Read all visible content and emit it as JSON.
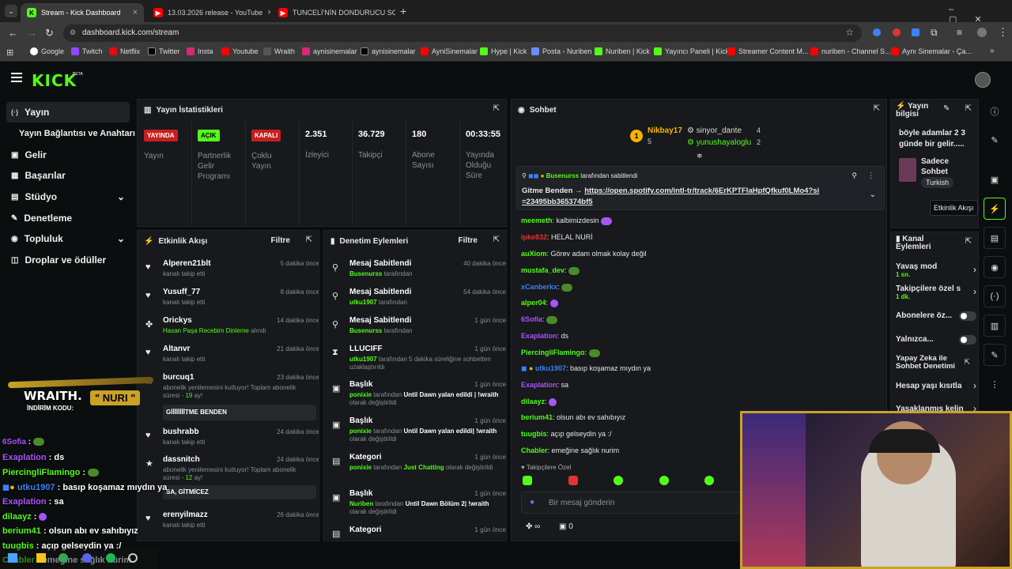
{
  "browser": {
    "tabs": [
      {
        "title": "Stream - Kick Dashboard",
        "active": true,
        "icon": "kick-icon"
      },
      {
        "title": "13.03.2026 release - YouTube",
        "active": false,
        "icon": "youtube-icon"
      },
      {
        "title": "TUNCELİ'NİN DONDURUCU SO",
        "active": false,
        "icon": "youtube-icon"
      }
    ],
    "url": "dashboard.kick.com/stream",
    "bookmarks": [
      "Google",
      "Twitch",
      "Netflix",
      "Twitter",
      "Insta",
      "Youtube",
      "Wraith",
      "aynisinemalar",
      "aynisinemalar",
      "AyniSinemalar",
      "Hype | Kick",
      "Posta - Nuriben",
      "Nuriben | Kick",
      "Yayıncı Paneli | Kick",
      "Streamer Content M...",
      "nuriben - Channel S...",
      "Aynı Sinemalar - Ça..."
    ]
  },
  "brand": {
    "logo": "KICK",
    "beta": "BETA",
    "accent": "#53fc18"
  },
  "sidebar": {
    "items": [
      {
        "label": "Yayın",
        "icon": "broadcast-icon"
      },
      {
        "label": "Yayın Bağlantısı ve Anahtarı",
        "icon": ""
      },
      {
        "label": "Gelir",
        "icon": "money-icon"
      },
      {
        "label": "Başarılar",
        "icon": "trophy-icon"
      },
      {
        "label": "Stüdyo",
        "icon": "studio-icon"
      },
      {
        "label": "Denetleme",
        "icon": "wrench-icon"
      },
      {
        "label": "Topluluk",
        "icon": "community-icon"
      },
      {
        "label": "Droplar ve ödüller",
        "icon": "gift-icon"
      }
    ]
  },
  "stats": {
    "title": "Yayın İstatistikleri",
    "badges": [
      {
        "badge": "YAYINDA",
        "label": "Yayın",
        "color": "#e3342f"
      },
      {
        "badge": "AÇIK",
        "label": "Partnerlik Gelir Programı",
        "color": "#53fc18"
      },
      {
        "badge": "KAPALI",
        "label": "Çoklu Yayın",
        "color": "#e3342f"
      }
    ],
    "numbers": [
      {
        "value": "2.351",
        "label": "İzleyici"
      },
      {
        "value": "36.729",
        "label": "Takipçi"
      },
      {
        "value": "180",
        "label": "Abone Sayısı"
      },
      {
        "value": "00:33:55",
        "label": "Yayında Olduğu Süre"
      }
    ]
  },
  "activity": {
    "title": "Etkinlik Akışı",
    "filter": "Filtre",
    "items": [
      {
        "name": "Alperen21blt",
        "time": "5 dakika önce",
        "sub": "kanalı takip etti",
        "icon": "heart-icon"
      },
      {
        "name": "Yusuff_77",
        "time": "8 dakika önce",
        "sub": "kanalı takip etti",
        "icon": "heart-icon"
      },
      {
        "name": "Orickys",
        "time": "14 dakika önce",
        "sub": "Hasan Paşa Recebim Dinleme",
        "sub2": "alındı",
        "icon": "points-icon"
      },
      {
        "name": "Altanvr",
        "time": "21 dakika önce",
        "sub": "kanalı takip etti",
        "icon": "heart-icon"
      },
      {
        "name": "burcuq1",
        "time": "23 dakika önce",
        "sub": "abonelik yenilemesini kutluyor! Toplam abonelik süresi - ",
        "months": "19",
        "sub3": " ay!",
        "message": "GİİİİİİİİTME BENDEN",
        "icon": "star-icon"
      },
      {
        "name": "bushrabb",
        "time": "24 dakika önce",
        "sub": "kanalı takip etti",
        "icon": "heart-icon"
      },
      {
        "name": "dassnitch",
        "time": "24 dakika önce",
        "sub": "abonelik yenilemesini kutluyor! Toplam abonelik süresi - ",
        "months": "12",
        "sub3": " ay!",
        "message": "SA, GİTMİCEZ",
        "icon": "star-icon"
      },
      {
        "name": "erenyilmazz",
        "time": "26 dakika önce",
        "sub": "kanalı takip etti",
        "icon": "heart-icon"
      }
    ]
  },
  "moderation": {
    "title": "Denetim Eylemleri",
    "filter": "Filtre",
    "items": [
      {
        "name": "Mesaj Sabitlendi",
        "time": "40 dakika önce",
        "actor": "Busenurss",
        "rest": " tarafından",
        "icon": "pin-icon"
      },
      {
        "name": "Mesaj Sabitlendi",
        "time": "54 dakika önce",
        "actor": "utku1907",
        "rest": " tarafından",
        "icon": "pin-icon"
      },
      {
        "name": "Mesaj Sabitlendi",
        "time": "1 gün önce",
        "actor": "Busenurss",
        "rest": " tarafından",
        "icon": "pin-icon"
      },
      {
        "name": "LLUCIFF",
        "time": "1 gün önce",
        "actor": "utku1907",
        "rest": " tarafından 5 dakika süreliğine sohbetten uzaklaştırıldı",
        "icon": "hourglass-icon"
      },
      {
        "name": "Başlık",
        "time": "1 gün önce",
        "actor": "ponixie",
        "rest": " tarafından ",
        "bold": "Until Dawn yalan edildi | !wraith",
        "rest2": " olarak değiştirildi",
        "icon": "title-icon"
      },
      {
        "name": "Başlık",
        "time": "1 gün önce",
        "actor": "ponixie",
        "rest": " tarafından ",
        "bold": "Until Dawn yalan edildi| !wraith",
        "rest2": " olarak değiştirildi",
        "icon": "title-icon"
      },
      {
        "name": "Kategori",
        "time": "1 gün önce",
        "actor": "ponixie",
        "rest": " tarafından ",
        "bold": "Just Chatting",
        "rest2": " olarak değiştirildi",
        "icon": "category-icon"
      },
      {
        "name": "Başlık",
        "time": "1 gün önce",
        "actor": "Nuriben",
        "rest": " tarafından ",
        "bold": "Until Dawn Bölüm 2| !wraith",
        "rest2": " olarak değiştirildi",
        "icon": "title-icon"
      },
      {
        "name": "Kategori",
        "time": "1 gün önce",
        "actor": "",
        "rest": "",
        "icon": "category-icon"
      }
    ]
  },
  "chat": {
    "title": "Sohbet",
    "top_gifters": [
      {
        "rank": "1",
        "name": "Nikbay17",
        "count": "5"
      },
      {
        "rank": "",
        "name": "sinyor_dante",
        "count": "4"
      },
      {
        "rank": "",
        "name": "yunushayaloglu",
        "count": "2"
      }
    ],
    "pinned": {
      "by": "Busenurss",
      "by_suffix": " tarafından sabitlendi",
      "text": "Gitme Benden → ",
      "link": "https://open.spotify.com/intl-tr/track/6ErKPTFlaHpfQfkuf0LMo4?si=23495bb365374bf5"
    },
    "messages": [
      {
        "user": "meemeth",
        "text": "kalbimizdesin",
        "color": "#53fc18"
      },
      {
        "user": "ipke832",
        "text": "HELAL NURİ",
        "color": "#e3342f"
      },
      {
        "user": "auXiom",
        "text": "Görev adam olmak kolay değil",
        "color": "#53fc18"
      },
      {
        "user": "mustafa_dev",
        "text": "",
        "color": "#53fc18",
        "emote": true
      },
      {
        "user": "xCanberkx",
        "text": "",
        "color": "#3b82f6",
        "emote": true
      },
      {
        "user": "alper04",
        "text": "",
        "color": "#53fc18",
        "emote": true
      },
      {
        "user": "6Sofia",
        "text": "",
        "color": "#a855f7",
        "emote": true
      },
      {
        "user": "Exaplation",
        "text": "ds",
        "color": "#a855f7"
      },
      {
        "user": "PiercingliFlamingo",
        "text": "",
        "color": "#53fc18",
        "emote": true
      },
      {
        "user": "utku1907",
        "text": "basıp koşamaz mıydın ya",
        "color": "#3b82f6"
      },
      {
        "user": "Exaplation",
        "text": "sa",
        "color": "#a855f7"
      },
      {
        "user": "dilaayz",
        "text": "",
        "color": "#53fc18",
        "emote": true
      },
      {
        "user": "berium41",
        "text": "olsun abı ev sahıbıyız",
        "color": "#53fc18"
      },
      {
        "user": "tuugbis",
        "text": "açıp gelseydin ya :/",
        "color": "#53fc18"
      },
      {
        "user": "Chabler",
        "text": "emeğine sağlık nurim",
        "color": "#53fc18"
      }
    ],
    "followers_only": "Takipçilere Özel",
    "input_placeholder": "Bir mesaj gönderin",
    "counter": "0"
  },
  "stream_info": {
    "title": "Yayın bilgisi",
    "text": "böyle adamlar 2 3 günde bir gelir.....",
    "category": "Sadece Sohbet",
    "language": "Turkish"
  },
  "channel_actions": {
    "title": "Kanal Eylemleri",
    "items": [
      {
        "label": "Yavaş mod",
        "sub": "1 sn.",
        "type": "arrow"
      },
      {
        "label": "Takipçilere özel s",
        "sub": "1 dk.",
        "type": "arrow"
      },
      {
        "label": "Abonelere öz...",
        "sub": "",
        "type": "toggle"
      },
      {
        "label": "Yalnızca...",
        "sub": "",
        "type": "toggle"
      },
      {
        "label": "Yapay Zeka ile Sohbet Denetimi",
        "sub": "",
        "type": "external"
      },
      {
        "label": "Hesap yaşı kısıtla",
        "sub": "",
        "type": "arrow"
      },
      {
        "label": "Yasaklanmış kelin",
        "sub": "",
        "type": "arrow"
      }
    ]
  },
  "tooltip": "Etkinlik Akışı",
  "overlay": {
    "brand": "WRAITH.",
    "code_label": "İNDİRİM KODU:",
    "code": "\" NURI \"",
    "chat": [
      {
        "user": "6Sofia",
        "text": "",
        "color": "#a855f7"
      },
      {
        "user": "Exaplation",
        "text": "ds",
        "color": "#a855f7"
      },
      {
        "user": "PiercingliFlamingo",
        "text": "",
        "color": "#53fc18"
      },
      {
        "user": "utku1907",
        "text": "basıp koşamaz mıydın ya",
        "color": "#3b82f6"
      },
      {
        "user": "Exaplation",
        "text": "sa",
        "color": "#a855f7"
      },
      {
        "user": "dilaayz",
        "text": "",
        "color": "#53fc18"
      },
      {
        "user": "berium41",
        "text": "olsun abı ev sahıbıyız",
        "color": "#53fc18"
      },
      {
        "user": "tuugbis",
        "text": "açıp gelseydin ya :/",
        "color": "#53fc18"
      },
      {
        "user": "Chabler",
        "text": "emeğine sağlık nurim",
        "color": "#53fc18"
      }
    ]
  }
}
